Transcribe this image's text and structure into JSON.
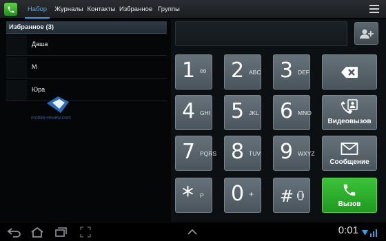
{
  "tabs": [
    {
      "label": "Набор",
      "active": true
    },
    {
      "label": "Журналы",
      "active": false
    },
    {
      "label": "Контакты",
      "active": false
    },
    {
      "label": "Избранное",
      "active": false
    },
    {
      "label": "Группы",
      "active": false
    }
  ],
  "favorites": {
    "header": "Избранное (3)",
    "contacts": [
      "Даша",
      "М",
      "Юра"
    ]
  },
  "watermark": "mobile-review.com",
  "dialer": {
    "number_value": "",
    "keys": [
      {
        "digit": "1",
        "letters": "∞"
      },
      {
        "digit": "2",
        "letters": "ABC"
      },
      {
        "digit": "3",
        "letters": "DEF"
      },
      {
        "digit": "4",
        "letters": "GHI"
      },
      {
        "digit": "5",
        "letters": "JKL"
      },
      {
        "digit": "6",
        "letters": "MNO"
      },
      {
        "digit": "7",
        "letters": "PQRS"
      },
      {
        "digit": "8",
        "letters": "TUV"
      },
      {
        "digit": "9",
        "letters": "WXYZ"
      },
      {
        "digit": "*",
        "letters": "P"
      },
      {
        "digit": "0",
        "letters": "+"
      },
      {
        "digit": "#",
        "letters": ""
      }
    ],
    "video_call_label": "Видеовызов",
    "message_label": "Сообщение",
    "call_label": "Вызов"
  },
  "system": {
    "clock": "0:01"
  },
  "colors": {
    "accent": "#2aa5ec",
    "call_green": "#2aae28",
    "key_gray": "#58636b"
  }
}
